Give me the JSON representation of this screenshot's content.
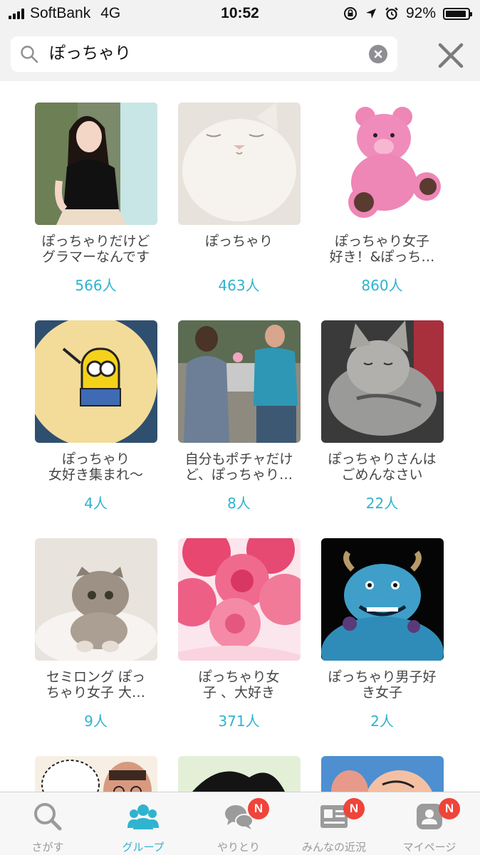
{
  "status_bar": {
    "carrier": "SoftBank",
    "network": "4G",
    "time": "10:52",
    "battery": "92%",
    "battery_level": 0.92
  },
  "search": {
    "query": "ぽっちゃり"
  },
  "groups": [
    {
      "name": "ぽっちゃりだけど\nグラマーなんです",
      "count": "566人",
      "thumb": "woman-photo"
    },
    {
      "name": "ぽっちゃり",
      "count": "463人",
      "thumb": "white-cat-photo"
    },
    {
      "name": "ぽっちゃり女子\n好き！&ぽっち…",
      "count": "860人",
      "thumb": "pink-teddy-bear-photo"
    },
    {
      "name": "ぽっちゃり\n女好き集まれ〜",
      "count": "4人",
      "thumb": "minion-cookie-photo"
    },
    {
      "name": "自分もポチャだけ\nど、ぽっちゃり…",
      "count": "8人",
      "thumb": "street-couple-photo"
    },
    {
      "name": "ぽっちゃりさんは\nごめんなさい",
      "count": "22人",
      "thumb": "tabby-kitten-photo"
    },
    {
      "name": "セミロング ぽっ\nちゃり女子 大…",
      "count": "9人",
      "thumb": "scottish-fold-cat-photo"
    },
    {
      "name": "ぽっちゃり女\n子 、大好き",
      "count": "371人",
      "thumb": "pink-roses-photo"
    },
    {
      "name": "ぽっちゃり男子好\nき女子",
      "count": "2人",
      "thumb": "sulley-monster-photo"
    },
    {
      "name": "",
      "count": "",
      "thumb": "manga-panel-photo"
    },
    {
      "name": "",
      "count": "",
      "thumb": "anime-character-photo"
    },
    {
      "name": "",
      "count": "",
      "thumb": "cartoon-character-photo"
    }
  ],
  "tabs": [
    {
      "label": "さがす",
      "icon": "search-icon",
      "badge": ""
    },
    {
      "label": "グループ",
      "icon": "group-icon",
      "badge": ""
    },
    {
      "label": "やりとり",
      "icon": "chat-icon",
      "badge": "N"
    },
    {
      "label": "みんなの近況",
      "icon": "news-card-icon",
      "badge": "N"
    },
    {
      "label": "マイページ",
      "icon": "profile-icon",
      "badge": "N"
    }
  ],
  "colors": {
    "accent": "#2fb3cf",
    "badge": "#f0443a",
    "inactive": "#999999"
  }
}
